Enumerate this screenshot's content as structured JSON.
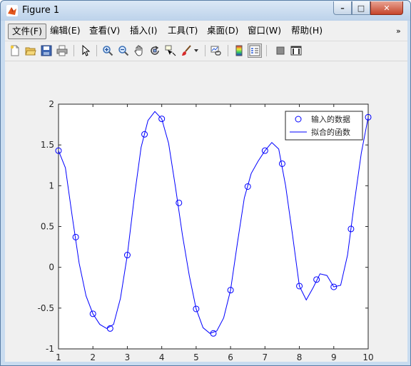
{
  "window": {
    "title": "Figure 1",
    "controls": {
      "minimize": "–",
      "maximize": "□",
      "close": "✕"
    }
  },
  "menubar": {
    "items": [
      {
        "label": "文件(F)",
        "active": true
      },
      {
        "label": "编辑(E)"
      },
      {
        "label": "查看(V)"
      },
      {
        "label": "插入(I)"
      },
      {
        "label": "工具(T)"
      },
      {
        "label": "桌面(D)"
      },
      {
        "label": "窗口(W)"
      },
      {
        "label": "帮助(H)"
      }
    ],
    "overflow": "»"
  },
  "toolbar": {
    "icons": [
      "new-figure-icon",
      "open-file-icon",
      "save-icon",
      "print-icon",
      "pointer-icon",
      "zoom-in-icon",
      "zoom-out-icon",
      "pan-hand-icon",
      "rotate-3d-icon",
      "data-cursor-icon",
      "brush-icon",
      "link-plot-icon",
      "colorbar-icon",
      "legend-icon",
      "hide-plot-tools-icon",
      "show-plot-tools-icon"
    ]
  },
  "chart_data": {
    "type": "line",
    "xlim": [
      1,
      10
    ],
    "ylim": [
      -1,
      2
    ],
    "x_ticks": [
      "1",
      "2",
      "3",
      "4",
      "5",
      "6",
      "7",
      "8",
      "9",
      "10"
    ],
    "y_ticks": [
      "-1",
      "-0.5",
      "0",
      "0.5",
      "1",
      "1.5",
      "2"
    ],
    "grid": false,
    "legend_position": "top-right",
    "series": [
      {
        "name": "输入的数据",
        "marker": "circle",
        "line": "none",
        "color": "#0000ff",
        "x": [
          1,
          1.5,
          2,
          2.5,
          3,
          3.5,
          4,
          4.5,
          5,
          5.5,
          6,
          6.5,
          7,
          7.5,
          8,
          8.5,
          9,
          9.5,
          10
        ],
        "y": [
          1.43,
          0.37,
          -0.57,
          -0.75,
          0.15,
          1.63,
          1.82,
          0.79,
          -0.51,
          -0.81,
          -0.28,
          0.99,
          1.43,
          1.27,
          -0.23,
          -0.15,
          -0.24,
          0.47,
          1.84
        ]
      },
      {
        "name": "拟合的函数",
        "marker": "none",
        "line": "solid",
        "color": "#0000ff",
        "x": [
          1,
          1.2,
          1.4,
          1.6,
          1.8,
          2,
          2.2,
          2.4,
          2.6,
          2.8,
          3,
          3.2,
          3.4,
          3.6,
          3.8,
          4,
          4.2,
          4.4,
          4.6,
          4.8,
          5,
          5.2,
          5.4,
          5.6,
          5.8,
          6,
          6.2,
          6.4,
          6.6,
          6.8,
          7,
          7.2,
          7.4,
          7.6,
          7.8,
          8,
          8.2,
          8.4,
          8.6,
          8.8,
          9,
          9.2,
          9.4,
          9.6,
          9.8,
          10
        ],
        "y": [
          1.43,
          1.22,
          0.62,
          0.05,
          -0.35,
          -0.57,
          -0.7,
          -0.75,
          -0.7,
          -0.38,
          0.15,
          0.85,
          1.47,
          1.8,
          1.91,
          1.82,
          1.52,
          0.98,
          0.4,
          -0.1,
          -0.51,
          -0.74,
          -0.81,
          -0.78,
          -0.62,
          -0.28,
          0.3,
          0.85,
          1.15,
          1.3,
          1.43,
          1.53,
          1.45,
          1.0,
          0.4,
          -0.23,
          -0.4,
          -0.25,
          -0.08,
          -0.1,
          -0.24,
          -0.22,
          0.15,
          0.8,
          1.4,
          1.84
        ]
      }
    ]
  }
}
